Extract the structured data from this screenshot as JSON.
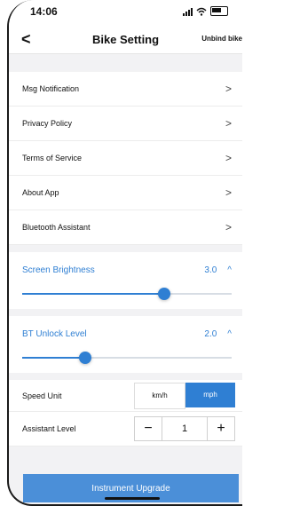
{
  "status": {
    "time": "14:06"
  },
  "header": {
    "title": "Bike Setting",
    "unbind": "Unbind bike"
  },
  "menu": [
    {
      "label": "Msg Notification"
    },
    {
      "label": "Privacy Policy"
    },
    {
      "label": "Terms of Service"
    },
    {
      "label": "About App"
    },
    {
      "label": "Bluetooth Assistant"
    }
  ],
  "brightness": {
    "label": "Screen Brightness",
    "value": "3.0",
    "level": 0.68
  },
  "bt_unlock": {
    "label": "BT Unlock Level",
    "value": "2.0",
    "level": 0.3
  },
  "speed_unit": {
    "label": "Speed Unit",
    "options": [
      "km/h",
      "mph"
    ],
    "selected": "mph"
  },
  "assistant_level": {
    "label": "Assistant Level",
    "value": "1",
    "minus": "−",
    "plus": "+"
  },
  "footer": {
    "upgrade": "Instrument Upgrade"
  },
  "colors": {
    "accent": "#2f7fd3",
    "button": "#4b8fd8"
  }
}
